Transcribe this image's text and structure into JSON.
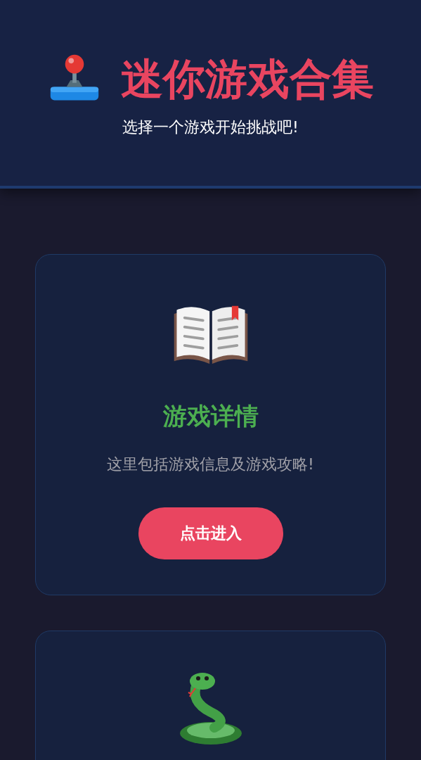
{
  "header": {
    "title": "迷你游戏合集",
    "subtitle": "选择一个游戏开始挑战吧!"
  },
  "cards": [
    {
      "kind": "book",
      "title": "游戏详情",
      "description": "这里包括游戏信息及游戏攻略!",
      "button": "点击进入"
    },
    {
      "kind": "snake"
    }
  ]
}
